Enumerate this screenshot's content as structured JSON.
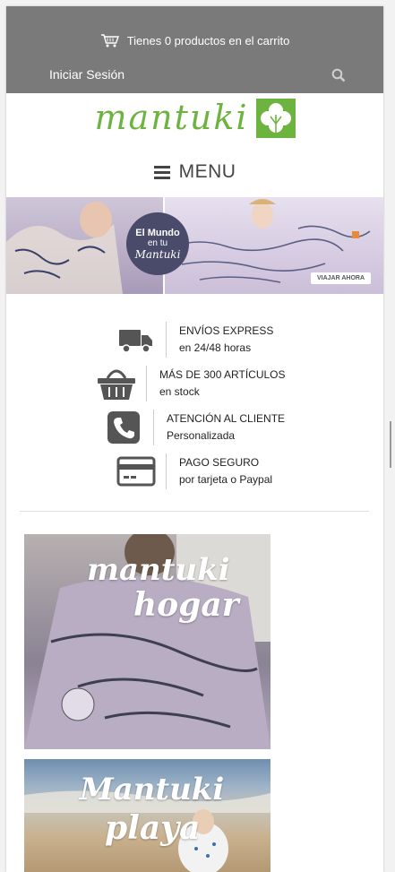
{
  "header": {
    "cart_text": "Tienes 0 productos en el carrito",
    "login_label": "Iniciar Sesión",
    "icons": {
      "cart": "cart-icon",
      "search": "search-icon"
    }
  },
  "logo": {
    "text": "mantuki",
    "emblem": "clover-logo-icon"
  },
  "nav": {
    "menu_label": "MENU",
    "icon": "hamburger-icon"
  },
  "banner": {
    "badge_line1": "El Mundo",
    "badge_line2": "en tu",
    "badge_line3": "Mantuki",
    "cta": "VIAJAR AHORA"
  },
  "features": [
    {
      "icon": "truck-icon",
      "title": "ENVÍOS EXPRESS",
      "subtitle": "en 24/48 horas"
    },
    {
      "icon": "basket-icon",
      "title": "MÁS DE 300 ARTÍCULOS",
      "subtitle": "en stock"
    },
    {
      "icon": "phone-icon",
      "title": "ATENCIÓN AL CLIENTE",
      "subtitle": "Personalizada"
    },
    {
      "icon": "credit-card-icon",
      "title": "PAGO SEGURO",
      "subtitle": "por tarjeta o Paypal"
    }
  ],
  "categories": [
    {
      "line1": "mantuki",
      "line2": "hogar"
    },
    {
      "line1": "Mantuki",
      "line2": "playa"
    }
  ],
  "colors": {
    "topbar": "#7a7a7a",
    "logo_green": "#6cb33f",
    "icon_gray": "#555555"
  }
}
